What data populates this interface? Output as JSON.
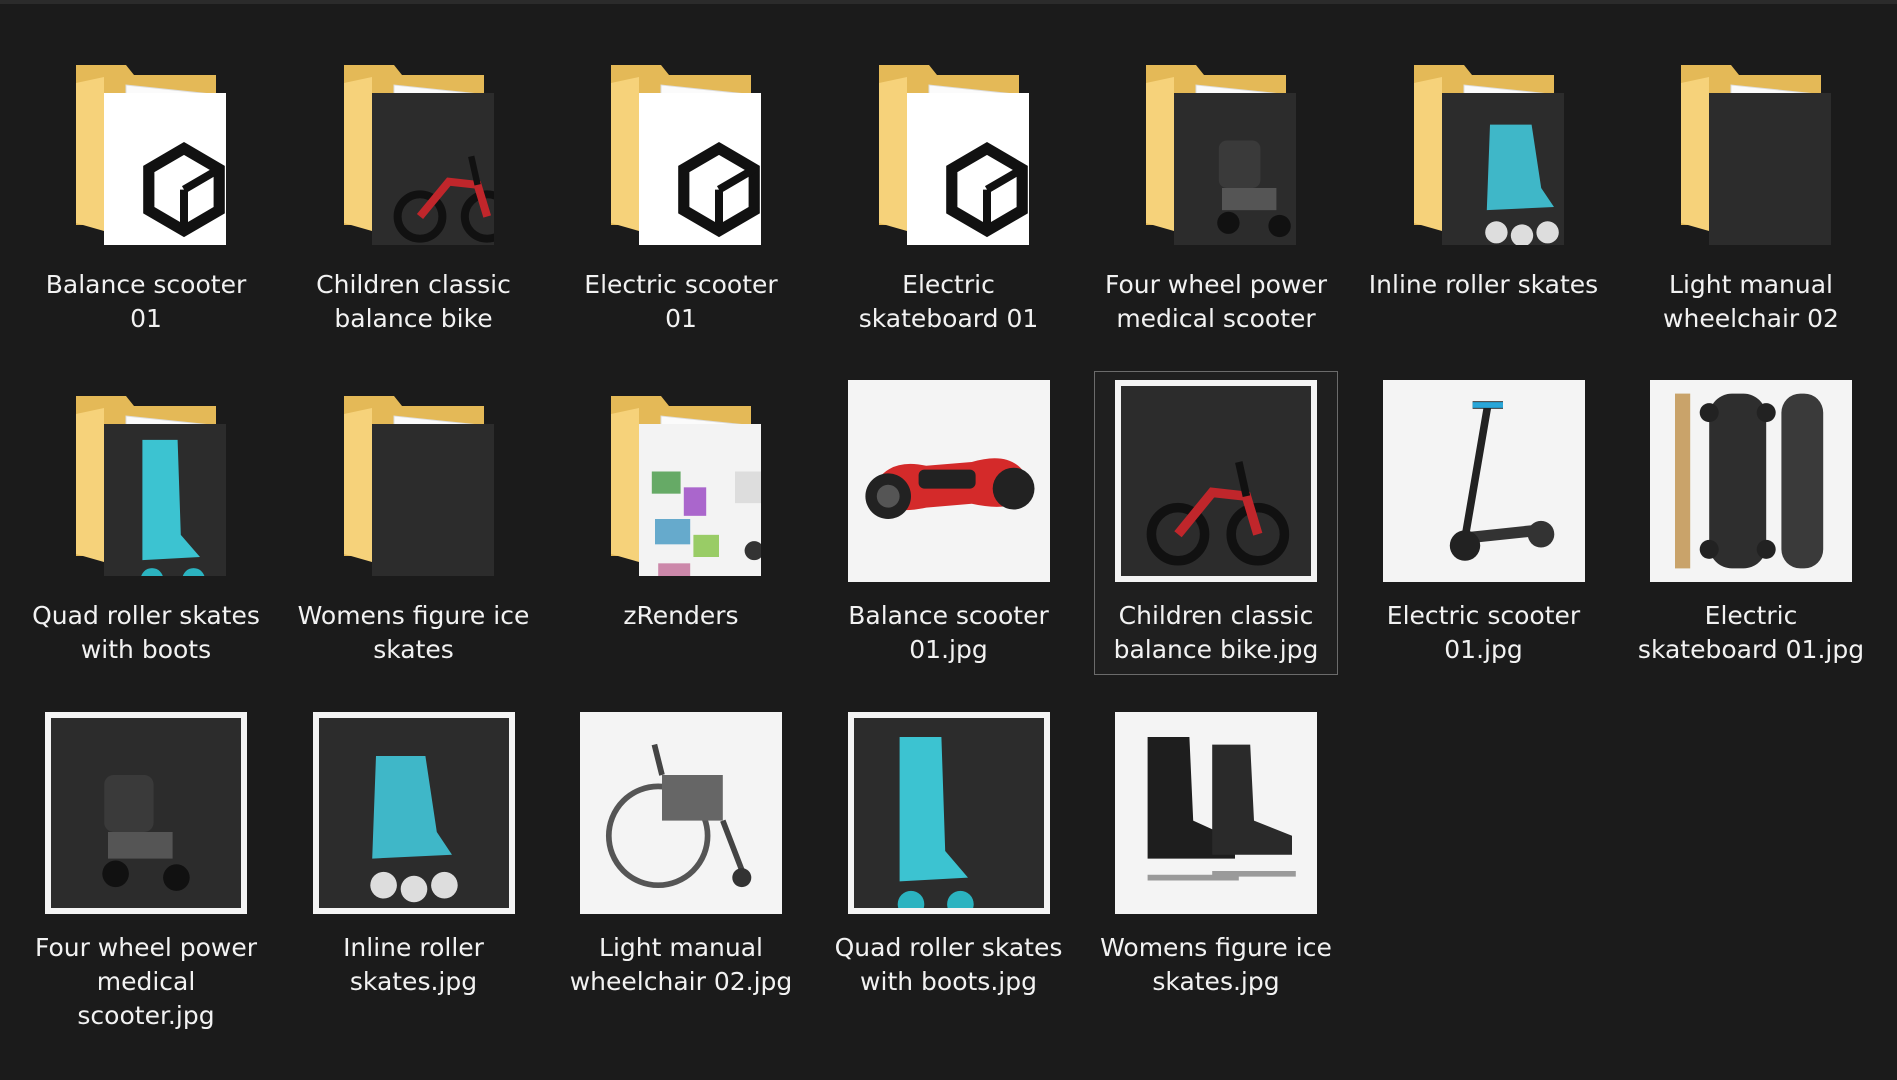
{
  "items": [
    {
      "label": "Balance scooter 01",
      "type": "folder",
      "preview": "dark-3d-logo",
      "icon": "folder-icon"
    },
    {
      "label": "Children classic balance bike",
      "type": "folder",
      "preview": "balance-bike",
      "icon": "folder-icon"
    },
    {
      "label": "Electric scooter 01",
      "type": "folder",
      "preview": "dark-3d-logo",
      "icon": "folder-icon"
    },
    {
      "label": "Electric skateboard 01",
      "type": "folder",
      "preview": "dark-3d-logo",
      "icon": "folder-icon"
    },
    {
      "label": "Four wheel power medical scooter",
      "type": "folder",
      "preview": "mobility-scooter",
      "icon": "folder-icon"
    },
    {
      "label": "Inline roller skates",
      "type": "folder",
      "preview": "inline-skates",
      "icon": "folder-icon"
    },
    {
      "label": "Light manual wheelchair 02",
      "type": "folder",
      "preview": "dark-page",
      "icon": "folder-icon"
    },
    {
      "label": "Quad roller skates with boots",
      "type": "folder",
      "preview": "quad-skates",
      "icon": "folder-icon"
    },
    {
      "label": "Womens figure ice skates",
      "type": "folder",
      "preview": "dark-page",
      "icon": "folder-icon"
    },
    {
      "label": "zRenders",
      "type": "folder",
      "preview": "renders",
      "icon": "folder-icon"
    },
    {
      "label": "Balance scooter 01.jpg",
      "type": "image",
      "preview": "hoverboard",
      "icon": "hoverboard-thumbnail"
    },
    {
      "label": "Children classic balance bike.jpg",
      "type": "image",
      "preview": "balance-bike",
      "icon": "balance-bike-thumbnail",
      "selected": true
    },
    {
      "label": "Electric scooter 01.jpg",
      "type": "image",
      "preview": "e-scooter",
      "icon": "electric-scooter-thumbnail"
    },
    {
      "label": "Electric skateboard 01.jpg",
      "type": "image",
      "preview": "skateboard",
      "icon": "electric-skateboard-thumbnail"
    },
    {
      "label": "Four wheel power medical scooter.jpg",
      "type": "image",
      "preview": "mobility-scooter",
      "icon": "mobility-scooter-thumbnail"
    },
    {
      "label": "Inline roller skates.jpg",
      "type": "image",
      "preview": "inline-skates",
      "icon": "inline-skates-thumbnail"
    },
    {
      "label": "Light manual wheelchair 02.jpg",
      "type": "image",
      "preview": "wheelchair",
      "icon": "wheelchair-thumbnail"
    },
    {
      "label": "Quad roller skates with boots.jpg",
      "type": "image",
      "preview": "quad-skates",
      "icon": "quad-skates-thumbnail"
    },
    {
      "label": "Womens figure ice skates.jpg",
      "type": "image",
      "preview": "ice-skates",
      "icon": "ice-skates-thumbnail"
    }
  ],
  "colors": {
    "background": "#1b1b1b",
    "folder_back": "#e8c062",
    "folder_front": "#f7d77a",
    "selection_border": "#6b6b6b",
    "text": "#f2f2f2"
  }
}
